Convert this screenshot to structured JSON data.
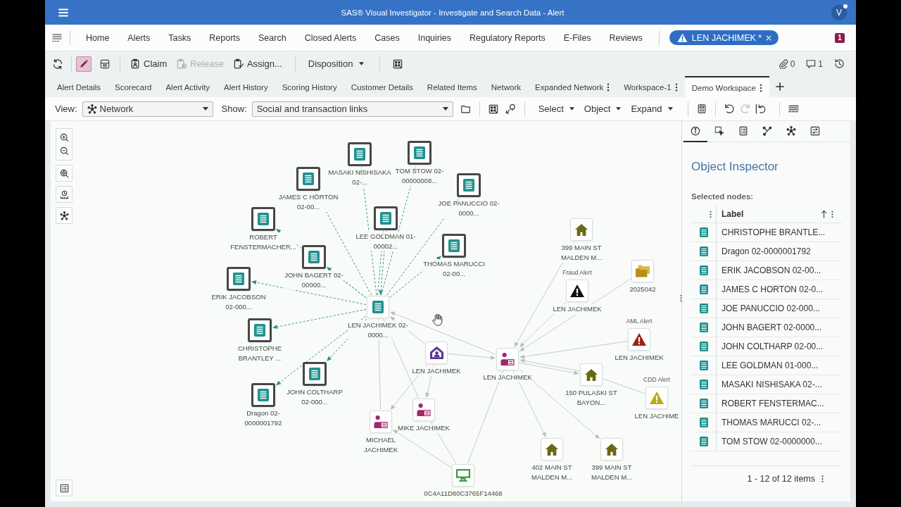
{
  "header": {
    "title": "SAS® Visual Investigator - Investigate and Search Data - Alert",
    "avatar": "V"
  },
  "nav": {
    "items": [
      "Home",
      "Alerts",
      "Tasks",
      "Reports",
      "Search",
      "Closed Alerts",
      "Cases",
      "Inquiries",
      "Regulatory Reports",
      "E-Files",
      "Reviews"
    ],
    "open_item": {
      "label": "LEN JACHIMEK *",
      "closable": true
    },
    "notifications": "1"
  },
  "toolbar": {
    "edit_mode": true,
    "actions": [
      {
        "kind": "claim",
        "label": "Claim",
        "disabled": false
      },
      {
        "kind": "release",
        "label": "Release",
        "disabled": true
      },
      {
        "kind": "assign",
        "label": "Assign...",
        "disabled": false
      }
    ],
    "disposition": "Disposition",
    "attachments": "0",
    "comments": "1"
  },
  "tabs": [
    {
      "label": "Alert Details",
      "menu": false,
      "selected": false
    },
    {
      "label": "Scorecard",
      "menu": false,
      "selected": false
    },
    {
      "label": "Alert Activity",
      "menu": false,
      "selected": false
    },
    {
      "label": "Alert History",
      "menu": false,
      "selected": false
    },
    {
      "label": "Scoring History",
      "menu": false,
      "selected": false
    },
    {
      "label": "Customer Details",
      "menu": false,
      "selected": false
    },
    {
      "label": "Related Items",
      "menu": false,
      "selected": false
    },
    {
      "label": "Network",
      "menu": false,
      "selected": false
    },
    {
      "label": "Expanded Network",
      "menu": true,
      "selected": false
    },
    {
      "label": "Workspace-1",
      "menu": true,
      "selected": false
    },
    {
      "label": "Demo Workspace",
      "menu": true,
      "selected": true
    }
  ],
  "graph_toolbar": {
    "view_label": "View:",
    "view": "Network",
    "show_label": "Show:",
    "show": "Social and transaction links",
    "menus": [
      "Select",
      "Object",
      "Expand"
    ],
    "history": [
      {
        "kind": "undo",
        "disabled": false
      },
      {
        "kind": "redo",
        "disabled": true
      },
      {
        "kind": "reset",
        "disabled": false
      }
    ]
  },
  "graph": {
    "nodes": [
      {
        "kind": "document",
        "label": "LEN JACHIMEK 02-\n0000...",
        "selected": false
      },
      {
        "kind": "document",
        "label": "MASAKI NISHISAKA\n02-...",
        "selected": true
      },
      {
        "kind": "document",
        "label": "TOM STOW 02-\n00000008...",
        "selected": true
      },
      {
        "kind": "document",
        "label": "JAMES C HORTON\n02-00...",
        "selected": true
      },
      {
        "kind": "document",
        "label": "JOE PANUCCIO 02-\n0000...",
        "selected": true
      },
      {
        "kind": "document",
        "label": "ROBERT\nFENSTERMACHER...",
        "selected": true
      },
      {
        "kind": "document",
        "label": "LEE GOLDMAN 01-\n00002...",
        "selected": true
      },
      {
        "kind": "document",
        "label": "JOHN BAGERT 02-\n00000...",
        "selected": true
      },
      {
        "kind": "document",
        "label": "THOMAS MARUCCI\n02-00...",
        "selected": true
      },
      {
        "kind": "document",
        "label": "ERIK JACOBSON\n02-000...",
        "selected": true
      },
      {
        "kind": "document",
        "label": "CHRISTOPHE\nBRANTLEY ...",
        "selected": true
      },
      {
        "kind": "document",
        "label": "JOHN COLTHARP\n02-000...",
        "selected": true
      },
      {
        "kind": "document",
        "label": "Dragon 02-\n0000001792",
        "selected": true
      },
      {
        "kind": "household",
        "label": "LEN JACHIMEK",
        "selected": false
      },
      {
        "kind": "person",
        "label": "LEN JACHIMEK",
        "selected": false
      },
      {
        "kind": "person",
        "label": "MIKE JACHIMEK",
        "selected": false
      },
      {
        "kind": "person",
        "label": "MICHAEL\nJACHIMEK",
        "selected": false
      },
      {
        "kind": "device",
        "label": "0C4A11D80C3765F14468",
        "selected": false
      },
      {
        "kind": "address",
        "label": "399 MAIN ST\nMALDEN M...",
        "selected": false
      },
      {
        "kind": "alert",
        "caption": "Fraud Alert",
        "label": "LEN JACHIMEK",
        "color": "#111111",
        "selected": false
      },
      {
        "kind": "case",
        "label": "2025042",
        "selected": false
      },
      {
        "kind": "alert",
        "caption": "AML Alert",
        "label": "LEN JACHIMEK",
        "color": "#a31d1d",
        "selected": false
      },
      {
        "kind": "address",
        "label": "150 PULASKI ST\nBAYON...",
        "selected": false
      },
      {
        "kind": "alert",
        "caption": "CDD Alert",
        "label": "LEN JACHIME",
        "color": "#b9a912",
        "selected": false
      },
      {
        "kind": "address",
        "label": "402 MAIN ST\nMALDEN M...",
        "selected": false
      },
      {
        "kind": "address",
        "label": "399 MAIN ST\nMALDEN M...",
        "selected": false
      }
    ]
  },
  "inspector": {
    "tabs": [
      {
        "kind": "info",
        "selected": true
      },
      {
        "kind": "selection",
        "selected": false
      },
      {
        "kind": "table",
        "selected": false
      },
      {
        "kind": "links",
        "selected": false
      },
      {
        "kind": "network",
        "selected": false
      },
      {
        "kind": "swap",
        "selected": false
      }
    ],
    "title": "Object Inspector",
    "subtitle": "Selected nodes:",
    "table": {
      "column": "Label",
      "sort_ascending": true,
      "rows": [
        {
          "kind": "document",
          "label": "CHRISTOPHE BRANTLE..."
        },
        {
          "kind": "document",
          "label": "Dragon 02-0000001792"
        },
        {
          "kind": "document",
          "label": "ERIK JACOBSON 02-00..."
        },
        {
          "kind": "document",
          "label": "JAMES C HORTON 02-0..."
        },
        {
          "kind": "document",
          "label": "JOE PANUCCIO 02-000..."
        },
        {
          "kind": "document",
          "label": "JOHN BAGERT 02-0000..."
        },
        {
          "kind": "document",
          "label": "JOHN COLTHARP 02-00..."
        },
        {
          "kind": "document",
          "label": "LEE GOLDMAN 01-000..."
        },
        {
          "kind": "document",
          "label": "MASAKI NISHISAKA 02-..."
        },
        {
          "kind": "document",
          "label": "ROBERT FENSTERMAC..."
        },
        {
          "kind": "document",
          "label": "THOMAS MARUCCI 02-..."
        },
        {
          "kind": "document",
          "label": "TOM STOW 02-0000000..."
        }
      ]
    },
    "pager": "1 - 12 of 12 items"
  }
}
